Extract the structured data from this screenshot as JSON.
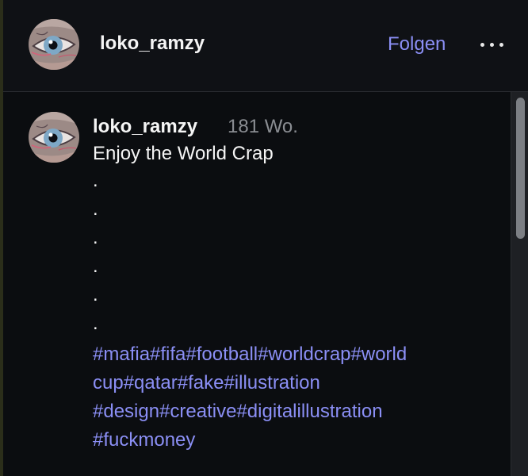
{
  "header": {
    "username": "loko_ramzy",
    "follow_label": "Folgen",
    "more_icon": "more-horizontal-icon"
  },
  "post": {
    "username": "loko_ramzy",
    "age": "181 Wo.",
    "caption": "Enjoy the World Crap",
    "dots": [
      ".",
      ".",
      ".",
      ".",
      ".",
      "."
    ],
    "hashtag_lines": [
      "#mafia#fifa#football#worldcrap#world",
      "cup#qatar#fake#illustration",
      "#design#creative#digitalillustration",
      "#fuckmoney"
    ]
  },
  "colors": {
    "background": "#0b0d10",
    "link": "#8b8ff5",
    "secondary_text": "#8a8d92",
    "primary_text": "#f5f5f5"
  }
}
